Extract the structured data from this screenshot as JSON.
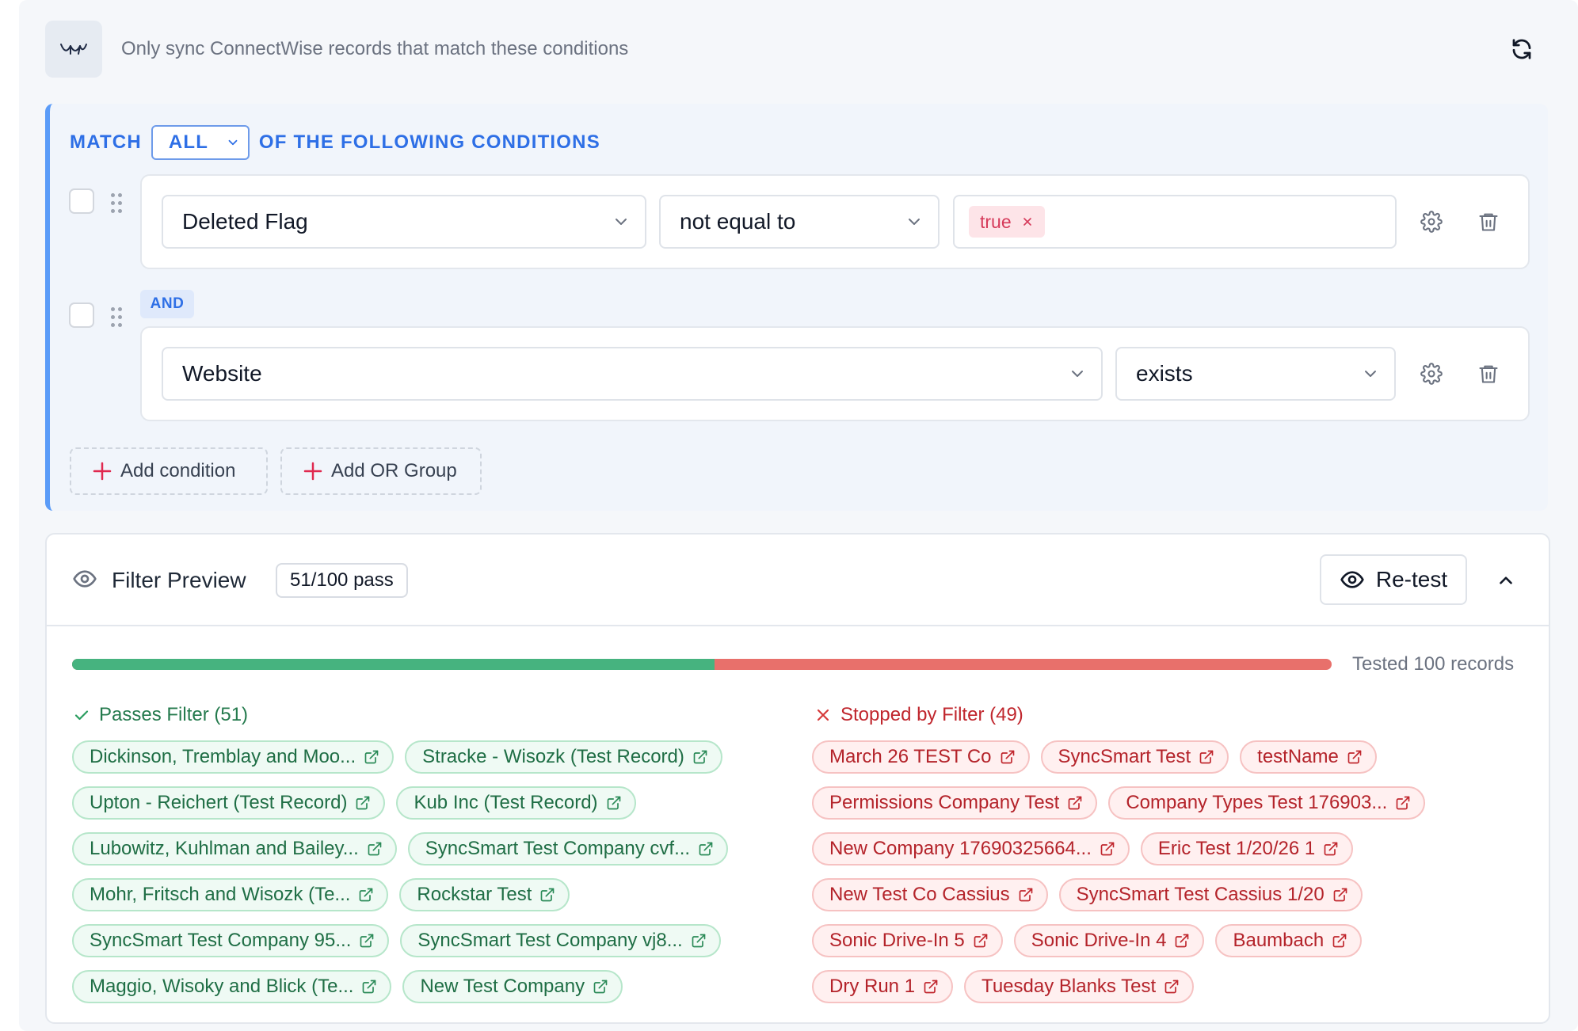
{
  "header": {
    "description": "Only sync ConnectWise records that match these conditions"
  },
  "match": {
    "prefix": "MATCH",
    "mode": "ALL",
    "suffix": "OF THE FOLLOWING CONDITIONS"
  },
  "conditions": [
    {
      "field": "Deleted Flag",
      "operator": "not equal to",
      "value": "true"
    },
    {
      "connector": "AND",
      "field": "Website",
      "operator": "exists"
    }
  ],
  "actions": {
    "add_condition": "Add condition",
    "add_or_group": "Add OR Group"
  },
  "preview": {
    "title": "Filter Preview",
    "count": "51/100 pass",
    "pass_fraction": 0.51,
    "retest_label": "Re-test",
    "tested": "Tested 100 records",
    "passes_heading": "Passes Filter (51)",
    "stopped_heading": "Stopped by Filter (49)",
    "passes": [
      "Dickinson, Tremblay and Moo...",
      "Stracke - Wisozk (Test Record)",
      "Upton - Reichert (Test Record)",
      "Kub Inc (Test Record)",
      "Lubowitz, Kuhlman and Bailey...",
      "SyncSmart Test Company cvf...",
      "Mohr, Fritsch and Wisozk (Te...",
      "Rockstar Test",
      "SyncSmart Test Company 95...",
      "SyncSmart Test Company vj8...",
      "Maggio, Wisoky and Blick (Te...",
      "New Test Company"
    ],
    "stopped": [
      "March 26 TEST Co",
      "SyncSmart Test",
      "testName",
      "Permissions Company Test",
      "Company Types Test 176903...",
      "New Company 17690325664...",
      "Eric Test 1/20/26 1",
      "New Test Co Cassius",
      "SyncSmart Test Cassius 1/20",
      "Sonic Drive-In 5",
      "Sonic Drive-In 4",
      "Baumbach",
      "Dry Run 1",
      "Tuesday Blanks Test"
    ]
  },
  "colors": {
    "accent": "#2e6fe6",
    "pass": "#46b37f",
    "stop": "#e8706b"
  },
  "icons": [
    "filter-icon",
    "sync-icon",
    "drag-handle-icon",
    "chevron-down-icon",
    "settings-icon",
    "trash-icon",
    "plus-icon",
    "eye-icon",
    "chevron-up-icon",
    "check-icon",
    "x-icon",
    "external-link-icon"
  ]
}
